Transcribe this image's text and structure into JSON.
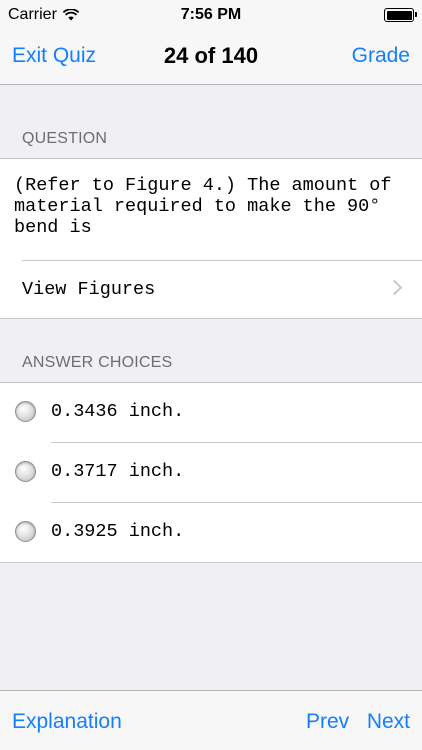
{
  "status_bar": {
    "carrier": "Carrier",
    "time": "7:56 PM"
  },
  "nav": {
    "exit_label": "Exit Quiz",
    "title": "24 of 140",
    "grade_label": "Grade"
  },
  "question": {
    "section_title": "QUESTION",
    "text": "(Refer to Figure 4.) The amount of material required to make the 90° bend is",
    "view_figures_label": "View Figures"
  },
  "answers": {
    "section_title": "ANSWER CHOICES",
    "choices": [
      {
        "label": "0.3436 inch."
      },
      {
        "label": "0.3717 inch."
      },
      {
        "label": "0.3925 inch."
      }
    ]
  },
  "toolbar": {
    "explanation_label": "Explanation",
    "prev_label": "Prev",
    "next_label": "Next"
  },
  "colors": {
    "accent": "#157efb",
    "background": "#efeff4",
    "bar": "#f7f7f7"
  }
}
